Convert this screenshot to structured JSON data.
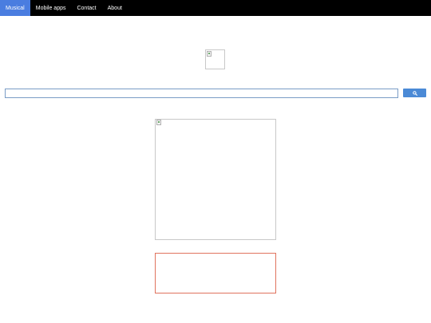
{
  "nav": {
    "items": [
      {
        "label": "Musical",
        "active": true
      },
      {
        "label": "Mobile apps",
        "active": false
      },
      {
        "label": "Contact",
        "active": false
      },
      {
        "label": "About",
        "active": false
      }
    ]
  },
  "logo": {
    "icon": "broken-image-icon"
  },
  "search": {
    "value": "",
    "placeholder": "",
    "button_icon": "search-icon"
  },
  "main_image": {
    "icon": "broken-image-icon"
  },
  "colors": {
    "nav_background": "#000000",
    "nav_active": "#4a7de0",
    "search_button": "#4b8ad6",
    "search_border": "#7a9cc6",
    "ad_border": "#e0735e"
  }
}
